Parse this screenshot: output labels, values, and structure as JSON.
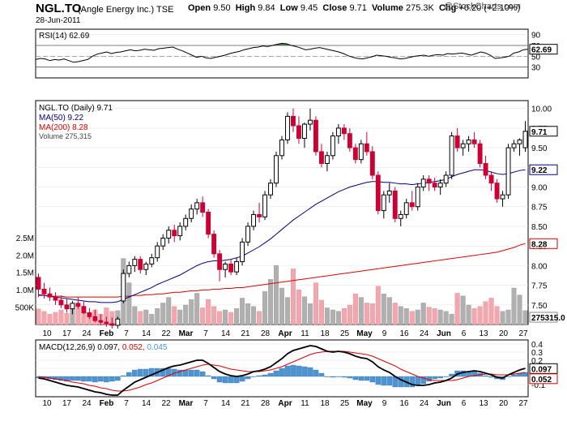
{
  "header": {
    "ticker": "NGL.TO",
    "company": "(Angle Energy Inc.)",
    "exchange": "TSE",
    "date": "28-Jun-2011",
    "open_label": "Open",
    "open": "9.50",
    "high_label": "High",
    "high": "9.84",
    "low_label": "Low",
    "low": "9.45",
    "close_label": "Close",
    "close": "9.71",
    "volume_label": "Volume",
    "volume": "275.3K",
    "chg_label": "Chg",
    "chg": "+0.20 (+2.10%)",
    "brand": "@StockCharts.com"
  },
  "colors": {
    "up": "#000000",
    "down": "#cc0033",
    "ma50": "#000080",
    "ma200": "#dd0000",
    "vol_up": "#b0b0b0",
    "vol_down": "#f0a8b0",
    "macd": "#000000",
    "signal": "#dd0000",
    "hist": "#4d94d0",
    "rsi_fill": "#4a7a4a"
  },
  "chart_data": [
    {
      "type": "line",
      "panel": "rsi",
      "legend": "RSI(14) 62.69",
      "ylim": [
        10,
        100
      ],
      "yticks": [
        90,
        70,
        50,
        30
      ],
      "overbought": 70,
      "oversold": 30,
      "value_label": "62.69",
      "values": [
        44,
        46,
        45,
        42,
        44,
        43,
        45,
        42,
        39,
        40,
        42,
        44,
        50,
        54,
        56,
        58,
        55,
        57,
        58,
        60,
        62,
        60,
        61,
        63,
        62,
        61,
        64,
        65,
        66,
        67,
        63,
        60,
        56,
        52,
        48,
        50,
        47,
        46,
        48,
        50,
        52,
        55,
        57,
        59,
        62,
        64,
        66,
        67,
        69,
        68,
        70,
        72,
        74,
        73,
        70,
        68,
        65,
        62,
        63,
        65,
        66,
        64,
        62,
        60,
        58,
        55,
        51,
        48,
        46,
        45,
        47,
        49,
        52,
        51,
        50,
        48,
        47,
        45,
        46,
        48,
        50,
        51,
        52,
        50,
        52,
        53,
        52,
        55,
        54,
        55,
        56,
        54,
        52,
        55,
        58,
        56,
        52,
        46,
        47,
        48,
        50,
        56,
        58,
        62,
        63
      ],
      "x_labels": [
        "10",
        "17",
        "24",
        "Feb",
        "7",
        "14",
        "22",
        "Mar",
        "7",
        "14",
        "21",
        "28",
        "Apr",
        "11",
        "18",
        "25",
        "May",
        "9",
        "16",
        "24",
        "Jun",
        "6",
        "13",
        "20",
        "27"
      ]
    },
    {
      "type": "candlestick",
      "panel": "price",
      "legend": [
        "NGL.TO (Daily) 9.71",
        "MA(50) 9.22",
        "MA(200) 8.28",
        "Volume 275,315"
      ],
      "ylim": [
        7.25,
        10.1
      ],
      "yticks": [
        10.0,
        9.75,
        9.5,
        9.25,
        9.0,
        8.75,
        8.5,
        8.25,
        8.0,
        7.75,
        7.5
      ],
      "ytick_labels": [
        "10.00",
        "9.75",
        "9.50",
        "9.25",
        "9.00",
        "8.75",
        "8.50",
        "8.25",
        "8.00",
        "7.75",
        "7.50"
      ],
      "value_tags": {
        "close": "9.71",
        "ma50": "9.22",
        "ma200": "8.28",
        "volume": "275315.0"
      },
      "volume_ylim": [
        0,
        2800000
      ],
      "volume_ticks": [
        "2.5M",
        "2.0M",
        "1.5M",
        "1.0M",
        "500K"
      ],
      "volume_tick_values": [
        2500000,
        2000000,
        1500000,
        1000000,
        500000
      ],
      "ohlc": [
        [
          7.85,
          7.9,
          7.6,
          7.7
        ],
        [
          7.7,
          7.78,
          7.58,
          7.64
        ],
        [
          7.64,
          7.72,
          7.55,
          7.6
        ],
        [
          7.6,
          7.66,
          7.5,
          7.56
        ],
        [
          7.56,
          7.62,
          7.46,
          7.5
        ],
        [
          7.5,
          7.58,
          7.4,
          7.45
        ],
        [
          7.45,
          7.55,
          7.38,
          7.52
        ],
        [
          7.52,
          7.6,
          7.45,
          7.48
        ],
        [
          7.48,
          7.54,
          7.38,
          7.4
        ],
        [
          7.4,
          7.46,
          7.32,
          7.35
        ],
        [
          7.35,
          7.44,
          7.28,
          7.3
        ],
        [
          7.3,
          7.38,
          7.24,
          7.28
        ],
        [
          7.28,
          7.35,
          7.22,
          7.26
        ],
        [
          7.26,
          7.34,
          7.2,
          7.24
        ],
        [
          7.24,
          7.35,
          7.2,
          7.32
        ],
        [
          7.55,
          7.95,
          7.52,
          7.9
        ],
        [
          7.9,
          8.05,
          7.85,
          8.0
        ],
        [
          8.0,
          8.12,
          7.92,
          8.08
        ],
        [
          8.08,
          8.12,
          7.9,
          7.95
        ],
        [
          7.95,
          8.05,
          7.88,
          8.02
        ],
        [
          8.02,
          8.15,
          7.98,
          8.1
        ],
        [
          8.1,
          8.3,
          8.05,
          8.25
        ],
        [
          8.25,
          8.4,
          8.2,
          8.35
        ],
        [
          8.35,
          8.5,
          8.28,
          8.45
        ],
        [
          8.45,
          8.52,
          8.3,
          8.38
        ],
        [
          8.38,
          8.55,
          8.32,
          8.5
        ],
        [
          8.5,
          8.65,
          8.45,
          8.6
        ],
        [
          8.6,
          8.78,
          8.55,
          8.72
        ],
        [
          8.72,
          8.85,
          8.65,
          8.8
        ],
        [
          8.8,
          8.88,
          8.62,
          8.68
        ],
        [
          8.68,
          8.72,
          8.35,
          8.4
        ],
        [
          8.4,
          8.45,
          8.1,
          8.15
        ],
        [
          8.15,
          8.2,
          7.8,
          7.95
        ],
        [
          7.95,
          8.05,
          7.85,
          8.02
        ],
        [
          8.02,
          8.08,
          7.88,
          7.92
        ],
        [
          7.92,
          8.1,
          7.88,
          8.05
        ],
        [
          8.05,
          8.35,
          8.0,
          8.3
        ],
        [
          8.3,
          8.55,
          8.25,
          8.5
        ],
        [
          8.5,
          8.7,
          8.45,
          8.65
        ],
        [
          8.65,
          8.8,
          8.55,
          8.62
        ],
        [
          8.62,
          8.95,
          8.58,
          8.9
        ],
        [
          8.9,
          9.1,
          8.85,
          9.05
        ],
        [
          9.05,
          9.45,
          9.0,
          9.4
        ],
        [
          9.4,
          9.65,
          9.35,
          9.6
        ],
        [
          9.6,
          9.95,
          9.55,
          9.9
        ],
        [
          9.9,
          10.0,
          9.7,
          9.78
        ],
        [
          9.78,
          9.9,
          9.55,
          9.62
        ],
        [
          9.62,
          9.82,
          9.5,
          9.8
        ],
        [
          9.8,
          10.0,
          9.72,
          9.85
        ],
        [
          9.85,
          9.9,
          9.4,
          9.45
        ],
        [
          9.45,
          9.55,
          9.25,
          9.3
        ],
        [
          9.3,
          9.45,
          9.2,
          9.4
        ],
        [
          9.4,
          9.7,
          9.35,
          9.65
        ],
        [
          9.65,
          9.8,
          9.55,
          9.75
        ],
        [
          9.75,
          9.8,
          9.6,
          9.68
        ],
        [
          9.68,
          9.75,
          9.45,
          9.5
        ],
        [
          9.5,
          9.55,
          9.3,
          9.35
        ],
        [
          9.35,
          9.6,
          9.3,
          9.55
        ],
        [
          9.55,
          9.7,
          9.4,
          9.45
        ],
        [
          9.45,
          9.52,
          9.1,
          9.15
        ],
        [
          9.15,
          9.2,
          8.65,
          8.7
        ],
        [
          8.7,
          8.95,
          8.6,
          8.9
        ],
        [
          8.9,
          9.05,
          8.8,
          8.95
        ],
        [
          8.95,
          9.0,
          8.55,
          8.6
        ],
        [
          8.6,
          8.7,
          8.5,
          8.65
        ],
        [
          8.65,
          8.85,
          8.6,
          8.8
        ],
        [
          8.8,
          8.95,
          8.7,
          8.75
        ],
        [
          8.75,
          9.05,
          8.7,
          9.0
        ],
        [
          9.0,
          9.15,
          8.95,
          9.1
        ],
        [
          9.1,
          9.15,
          8.95,
          9.05
        ],
        [
          9.05,
          9.12,
          8.95,
          9.0
        ],
        [
          9.0,
          9.1,
          8.9,
          9.05
        ],
        [
          9.05,
          9.2,
          9.0,
          9.15
        ],
        [
          9.15,
          9.7,
          9.1,
          9.65
        ],
        [
          9.65,
          9.75,
          9.45,
          9.5
        ],
        [
          9.5,
          9.6,
          9.4,
          9.55
        ],
        [
          9.55,
          9.65,
          9.45,
          9.6
        ],
        [
          9.6,
          9.7,
          9.5,
          9.55
        ],
        [
          9.55,
          9.6,
          9.25,
          9.3
        ],
        [
          9.3,
          9.4,
          9.1,
          9.15
        ],
        [
          9.15,
          9.2,
          8.95,
          9.05
        ],
        [
          9.05,
          9.1,
          8.8,
          8.85
        ],
        [
          8.85,
          8.95,
          8.75,
          8.9
        ],
        [
          8.9,
          9.55,
          8.85,
          9.5
        ],
        [
          9.5,
          9.6,
          9.45,
          9.55
        ],
        [
          9.55,
          9.62,
          9.4,
          9.6
        ],
        [
          9.5,
          9.84,
          9.45,
          9.71
        ]
      ],
      "ma50": [
        7.63,
        7.62,
        7.61,
        7.6,
        7.59,
        7.58,
        7.57,
        7.56,
        7.55,
        7.54,
        7.54,
        7.53,
        7.53,
        7.53,
        7.54,
        7.57,
        7.6,
        7.63,
        7.66,
        7.69,
        7.72,
        7.76,
        7.79,
        7.82,
        7.85,
        7.88,
        7.92,
        7.96,
        8.0,
        8.03,
        8.05,
        8.06,
        8.06,
        8.07,
        8.08,
        8.1,
        8.12,
        8.16,
        8.2,
        8.24,
        8.29,
        8.34,
        8.4,
        8.46,
        8.52,
        8.58,
        8.63,
        8.68,
        8.73,
        8.78,
        8.82,
        8.86,
        8.9,
        8.94,
        8.97,
        9.0,
        9.02,
        9.04,
        9.06,
        9.07,
        9.07,
        9.06,
        9.06,
        9.05,
        9.04,
        9.04,
        9.03,
        9.04,
        9.05,
        9.06,
        9.07,
        9.08,
        9.1,
        9.13,
        9.16,
        9.18,
        9.2,
        9.22,
        9.22,
        9.21,
        9.19,
        9.17,
        9.16,
        9.17,
        9.19,
        9.21,
        9.22
      ],
      "ma200": [
        7.62,
        7.62,
        7.61,
        7.61,
        7.61,
        7.6,
        7.6,
        7.6,
        7.6,
        7.6,
        7.6,
        7.6,
        7.6,
        7.6,
        7.6,
        7.61,
        7.61,
        7.62,
        7.62,
        7.63,
        7.63,
        7.64,
        7.64,
        7.65,
        7.66,
        7.66,
        7.67,
        7.68,
        7.68,
        7.69,
        7.69,
        7.7,
        7.7,
        7.71,
        7.71,
        7.72,
        7.72,
        7.73,
        7.74,
        7.75,
        7.76,
        7.77,
        7.78,
        7.79,
        7.8,
        7.81,
        7.82,
        7.83,
        7.84,
        7.85,
        7.86,
        7.87,
        7.88,
        7.89,
        7.9,
        7.91,
        7.92,
        7.93,
        7.94,
        7.95,
        7.96,
        7.97,
        7.98,
        7.99,
        8.0,
        8.01,
        8.02,
        8.03,
        8.04,
        8.05,
        8.06,
        8.07,
        8.08,
        8.09,
        8.1,
        8.11,
        8.12,
        8.13,
        8.14,
        8.15,
        8.16,
        8.17,
        8.19,
        8.21,
        8.23,
        8.26,
        8.28
      ],
      "volume": [
        450000,
        380000,
        300000,
        350000,
        420000,
        320000,
        600000,
        480000,
        380000,
        350000,
        420000,
        300000,
        480000,
        380000,
        400000,
        1900000,
        1200000,
        520000,
        380000,
        420000,
        300000,
        460000,
        620000,
        780000,
        520000,
        420000,
        560000,
        720000,
        900000,
        480000,
        720000,
        520000,
        380000,
        420000,
        350000,
        460000,
        760000,
        600000,
        520000,
        380000,
        950000,
        1300000,
        1700000,
        1050000,
        780000,
        1600000,
        1000000,
        800000,
        600000,
        1200000,
        700000,
        480000,
        420000,
        380000,
        460000,
        560000,
        880000,
        780000,
        620000,
        600000,
        1100000,
        880000,
        780000,
        620000,
        520000,
        460000,
        380000,
        420000,
        620000,
        500000,
        460000,
        420000,
        380000,
        300000,
        900000,
        820000,
        560000,
        460000,
        520000,
        660000,
        760000,
        520000,
        380000,
        420000,
        1050000,
        850000,
        400000
      ],
      "x_labels": [
        "10",
        "17",
        "24",
        "Feb",
        "7",
        "14",
        "22",
        "Mar",
        "7",
        "14",
        "21",
        "28",
        "Apr",
        "11",
        "18",
        "25",
        "May",
        "9",
        "16",
        "24",
        "Jun",
        "6",
        "13",
        "20",
        "27"
      ]
    },
    {
      "type": "line",
      "panel": "macd",
      "legend": "MACD(12,26,9)",
      "legend_values": [
        "0.097",
        "0.052",
        "0.045"
      ],
      "ylim": [
        -0.25,
        0.45
      ],
      "yticks": [
        0.4,
        0.3,
        0.2,
        0.1,
        0.0,
        -0.1
      ],
      "ytick_labels": [
        "0.4",
        "0.3",
        "0.2",
        "0.1",
        "0.0",
        "-0.1"
      ],
      "value_tags": {
        "macd": "0.097",
        "signal": "0.052"
      },
      "macd": [
        -0.02,
        -0.03,
        -0.05,
        -0.07,
        -0.09,
        -0.11,
        -0.12,
        -0.13,
        -0.15,
        -0.17,
        -0.19,
        -0.2,
        -0.22,
        -0.23,
        -0.23,
        -0.17,
        -0.12,
        -0.07,
        -0.04,
        -0.01,
        0.02,
        0.05,
        0.08,
        0.11,
        0.13,
        0.14,
        0.16,
        0.18,
        0.2,
        0.2,
        0.16,
        0.11,
        0.06,
        0.03,
        0.01,
        0.0,
        0.01,
        0.03,
        0.06,
        0.07,
        0.09,
        0.12,
        0.17,
        0.22,
        0.28,
        0.32,
        0.34,
        0.36,
        0.38,
        0.37,
        0.34,
        0.31,
        0.3,
        0.31,
        0.3,
        0.28,
        0.25,
        0.23,
        0.22,
        0.18,
        0.12,
        0.08,
        0.05,
        0.0,
        -0.04,
        -0.07,
        -0.1,
        -0.11,
        -0.11,
        -0.1,
        -0.08,
        -0.07,
        -0.05,
        -0.02,
        0.03,
        0.05,
        0.06,
        0.07,
        0.06,
        0.04,
        0.02,
        -0.01,
        -0.02,
        0.02,
        0.05,
        0.08,
        0.1
      ],
      "signal": [
        0.0,
        -0.01,
        -0.02,
        -0.03,
        -0.04,
        -0.05,
        -0.07,
        -0.08,
        -0.09,
        -0.11,
        -0.12,
        -0.14,
        -0.15,
        -0.17,
        -0.18,
        -0.18,
        -0.17,
        -0.15,
        -0.13,
        -0.1,
        -0.08,
        -0.05,
        -0.02,
        0.01,
        0.04,
        0.06,
        0.08,
        0.1,
        0.12,
        0.14,
        0.15,
        0.14,
        0.13,
        0.11,
        0.09,
        0.08,
        0.07,
        0.06,
        0.06,
        0.06,
        0.07,
        0.08,
        0.1,
        0.12,
        0.15,
        0.18,
        0.21,
        0.24,
        0.27,
        0.29,
        0.3,
        0.31,
        0.31,
        0.31,
        0.31,
        0.3,
        0.29,
        0.28,
        0.27,
        0.25,
        0.22,
        0.19,
        0.16,
        0.13,
        0.09,
        0.06,
        0.03,
        0.0,
        -0.02,
        -0.04,
        -0.05,
        -0.05,
        -0.05,
        -0.05,
        -0.04,
        -0.02,
        0.0,
        0.01,
        0.02,
        0.03,
        0.03,
        0.02,
        0.02,
        0.02,
        0.03,
        0.04,
        0.05
      ],
      "x_labels": [
        "10",
        "17",
        "24",
        "Feb",
        "7",
        "14",
        "22",
        "Mar",
        "7",
        "14",
        "21",
        "28",
        "Apr",
        "11",
        "18",
        "25",
        "May",
        "9",
        "16",
        "24",
        "Jun",
        "6",
        "13",
        "20",
        "27"
      ]
    }
  ]
}
